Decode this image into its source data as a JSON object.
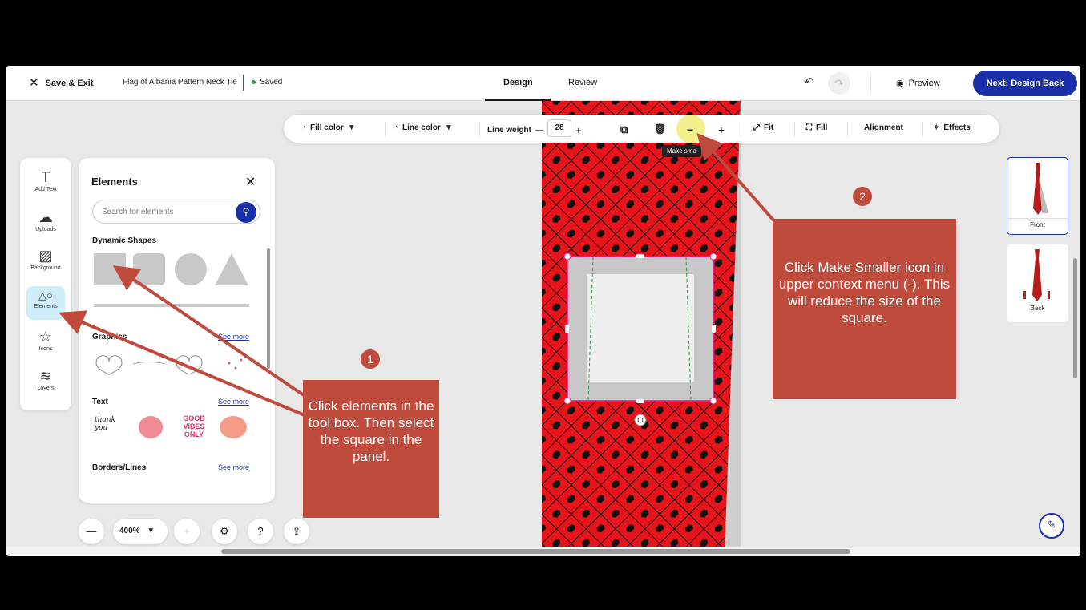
{
  "topbar": {
    "save_exit": "Save & Exit",
    "doc_title": "Flag of Albania Pattern Neck Tie",
    "saved": "Saved",
    "tabs": [
      {
        "label": "Design"
      },
      {
        "label": "Review"
      }
    ],
    "preview": "Preview",
    "next": "Next: Design Back"
  },
  "context_toolbar": {
    "fill_color": "Fill color",
    "line_color": "Line color",
    "line_weight": "Line weight",
    "line_weight_value": "28",
    "fit": "Fit",
    "fill": "Fill",
    "alignment": "Alignment",
    "effects": "Effects",
    "tooltip": "Make sma"
  },
  "rail": {
    "items": [
      {
        "label": "Add Text"
      },
      {
        "label": "Uploads"
      },
      {
        "label": "Background"
      },
      {
        "label": "Elements"
      },
      {
        "label": "Icons"
      },
      {
        "label": "Layers"
      }
    ]
  },
  "panel": {
    "title": "Elements",
    "search_placeholder": "Search for elements",
    "sections": {
      "dynamic_shapes": "Dynamic Shapes",
      "graphics": "Graphics",
      "text": "Text",
      "borders": "Borders/Lines"
    },
    "see_more": "See more",
    "stickers": {
      "thank": "thank you",
      "good": "GOOD VIBES ONLY"
    }
  },
  "thumbnails": [
    {
      "label": "Front"
    },
    {
      "label": "Back"
    }
  ],
  "bottom": {
    "zoom": "400%"
  },
  "annotations": {
    "step1_num": "1",
    "step1_text": "Click elements in the tool box. Then select the square in the panel.",
    "step2_num": "2",
    "step2_text": "Click Make Smaller icon in upper context menu (-). This will reduce the size of the square."
  },
  "colors": {
    "accent": "#1a2fa8",
    "tie_red": "#e8141c",
    "callout": "#bf4b3d",
    "highlight": "#f1f08a"
  }
}
